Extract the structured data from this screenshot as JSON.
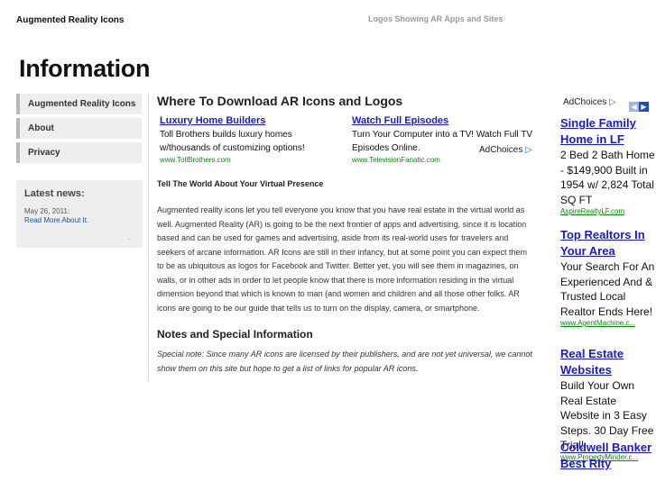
{
  "site": {
    "title": "Augmented Reality Icons",
    "tagline": "Logos Showing AR Apps and Sites"
  },
  "page": {
    "heading": "Information"
  },
  "sidebar": {
    "items": [
      {
        "label": "Augmented Reality Icons"
      },
      {
        "label": "About"
      },
      {
        "label": "Privacy"
      }
    ],
    "news": {
      "title": "Latest news:",
      "date": "May 26, 2011:",
      "link": "Read More About It.",
      "dot": "."
    }
  },
  "main": {
    "title": "Where To Download AR Icons and Logos",
    "ads": [
      {
        "title": "Luxury Home Builders",
        "desc": "Toll Brothers builds luxury homes w/thousands of customizing options!",
        "url": "www.TollBrothers.com"
      },
      {
        "title": "Watch Full Episodes",
        "desc": "Turn Your Computer into a TV! Watch Full TV Episodes Online.",
        "url": "www.TelevisionFanatic.com"
      }
    ],
    "adchoices": "AdChoices",
    "section_title": "Tell The World About Your Virtual Presence",
    "body": "Augmented reality icons let you tell everyone you know that you have real estate in the virtual world as well. Augmented Reality (AR) is going to be the next frontier of apps and advertising, since it is location based and can be used for games and advertising, aside from its real-world uses for travelers and seekers of arcane information. AR Icons are still in their infancy, but at some point you can expect them to be as ubiquitous as logos for Facebook and Twitter. Better yet, you will see them in magazines, on walls, or in other ads in order to let people know that there is more information residing in the virtual dimension beyond that which is known to man (and women and children and all those other folks. AR icons are going to be our guide that tells us to turn on the display, camera, or smartphone.",
    "notes_title": "Notes and Special Information",
    "notes": "Special note: Since many AR icons are licensed by their publishers, and are not yet universal, we cannot show them on this site but hope to get a list of links for popular AR icons."
  },
  "right_ads": {
    "header": "AdChoices",
    "prev_icon": "chevron-left-icon",
    "next_icon": "chevron-right-icon",
    "items": [
      {
        "title": "Single Family Home in LF",
        "desc": "2 Bed 2 Bath Home - $149,900 Built in 1954 w/ 2,824 Total SQ FT",
        "url": "AspireRealtyLF.com"
      },
      {
        "title": "Top Realtors In Your Area",
        "desc": "Your Search For An Experienced And & Trusted Local Realtor Ends Here!",
        "url": "www.AgentMachine.c..."
      },
      {
        "title": "Real Estate Websites",
        "desc": "Build Your Own Real Estate Website in 3 Easy Steps. 30 Day Free Trial!",
        "url": "www.PropertyMinder.c..."
      },
      {
        "title": "Coldwell Banker Best Rlty",
        "desc": "",
        "url": ""
      }
    ]
  },
  "colors": {
    "link_blue": "#1a1acc",
    "url_green": "#0a8a0a",
    "sidebar_bg": "#eeeeee"
  }
}
